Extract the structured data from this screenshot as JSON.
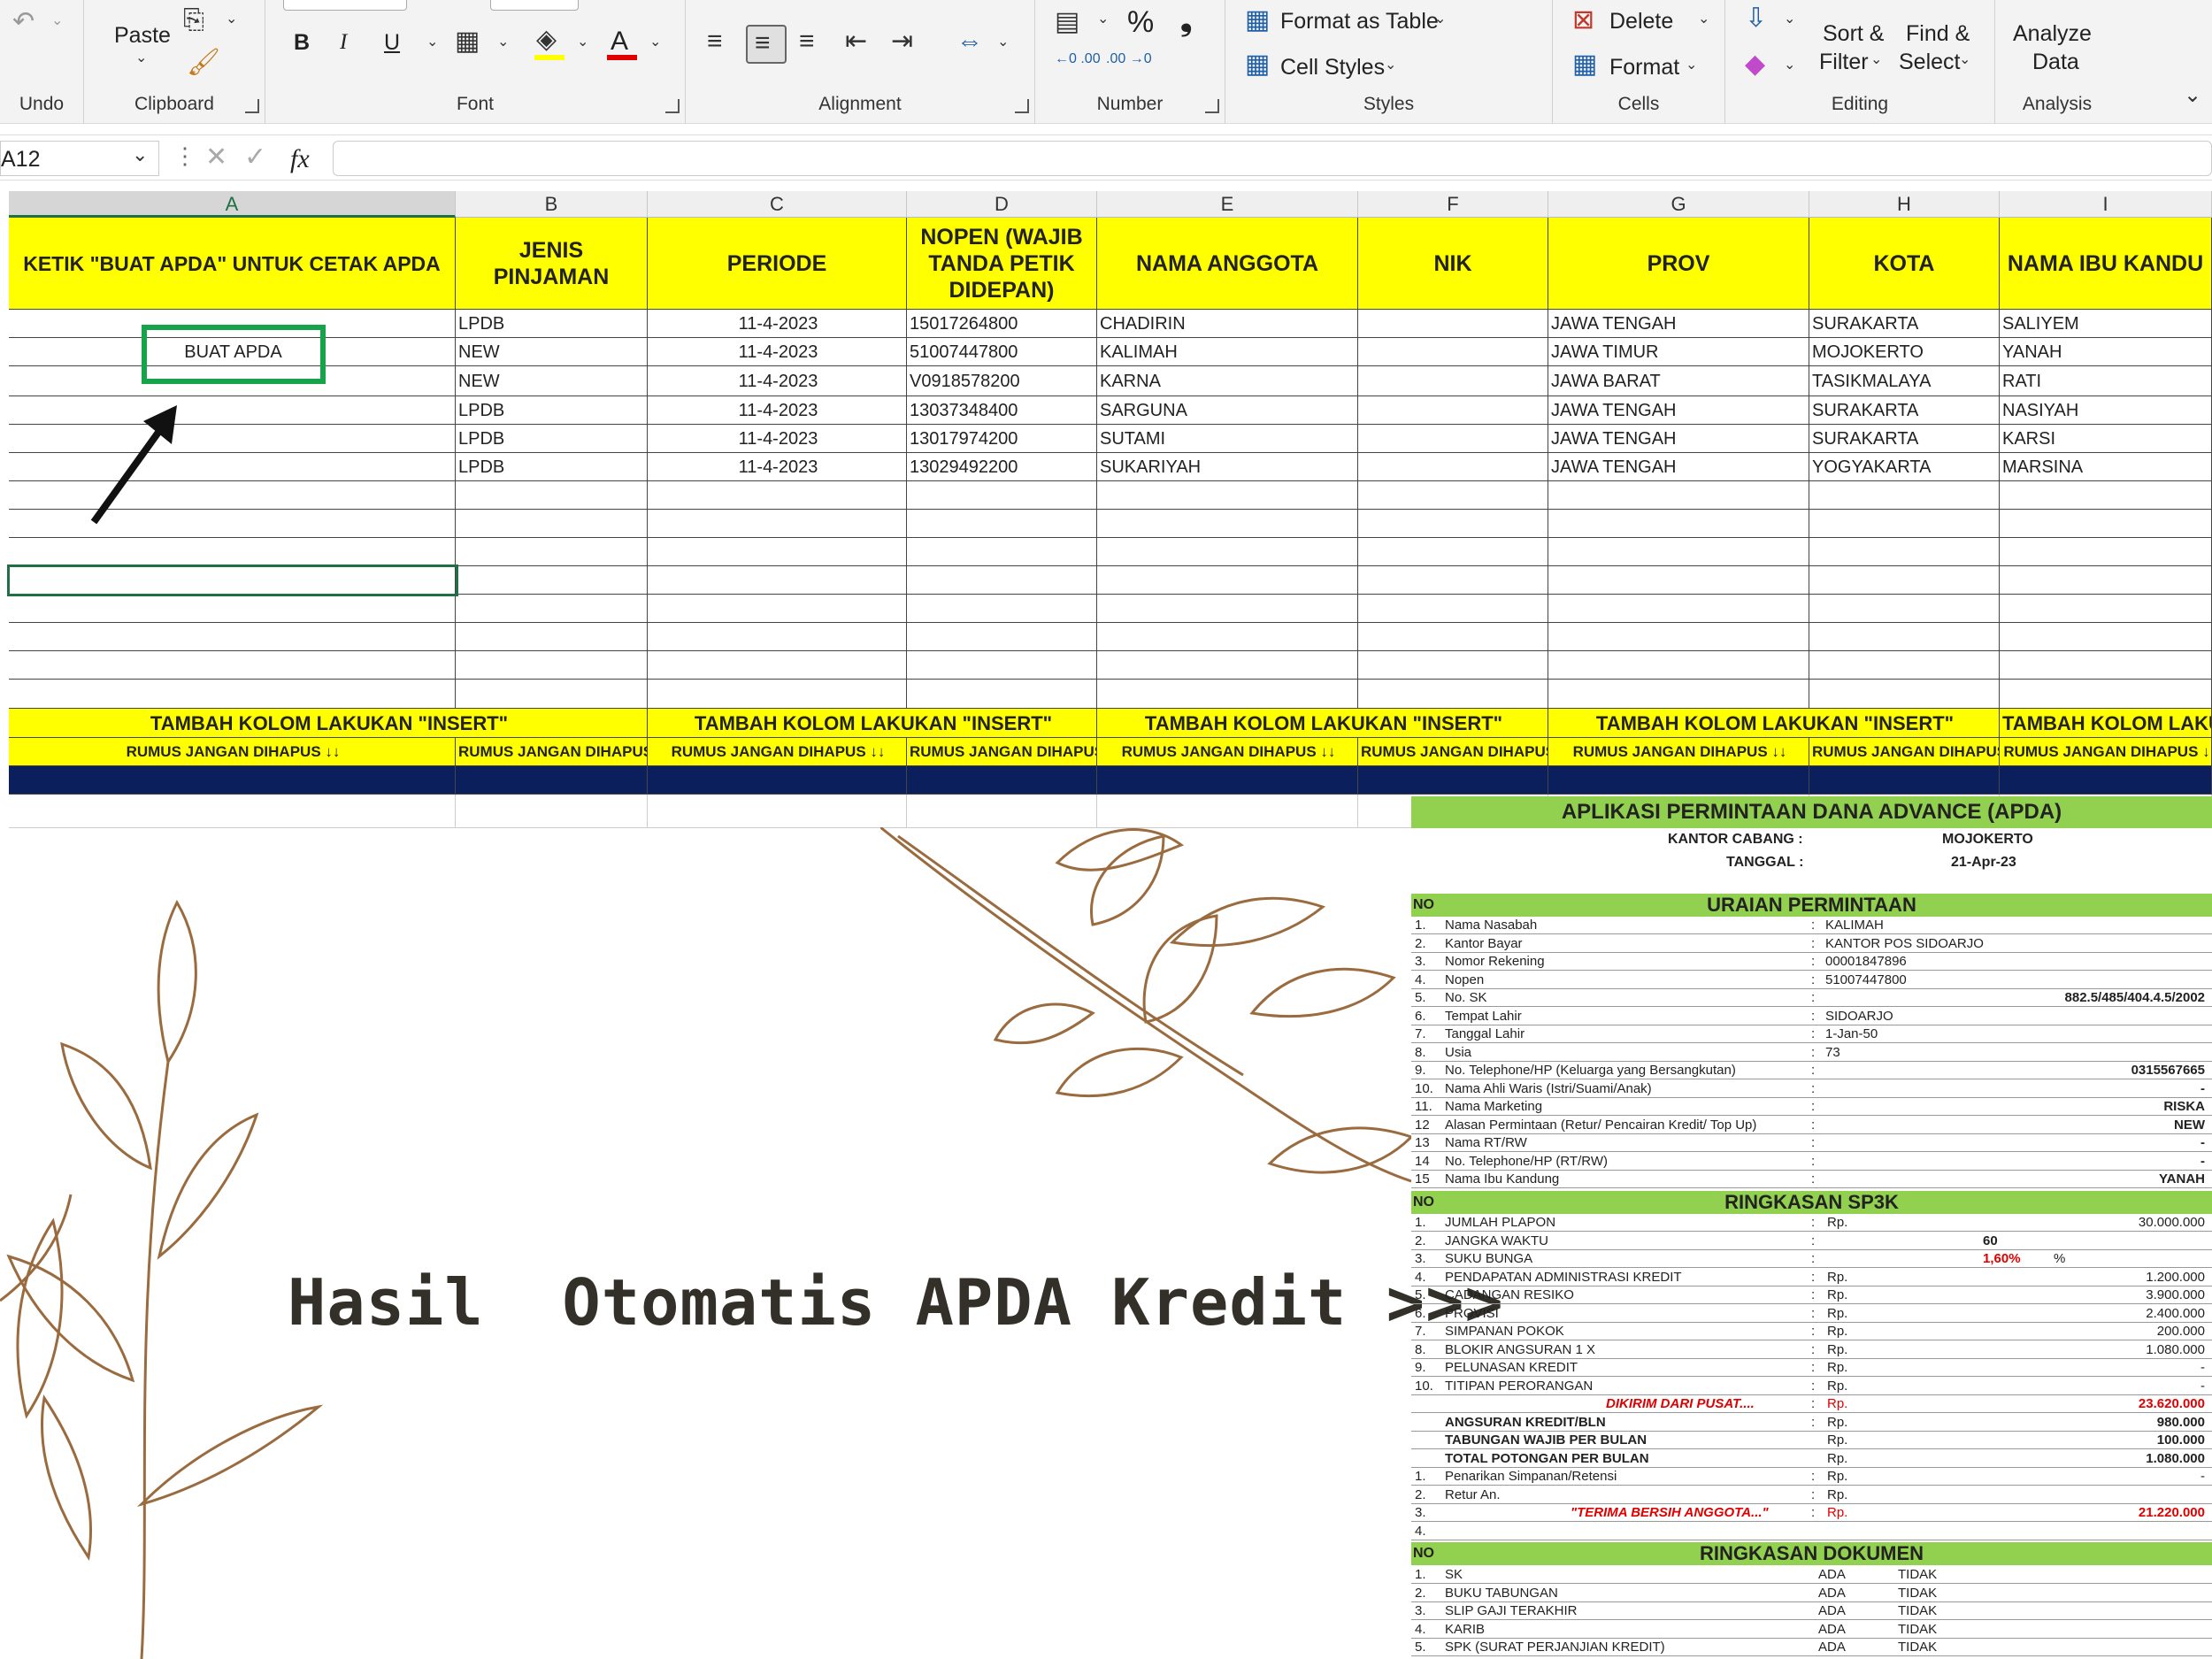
{
  "ribbon": {
    "undo_label": "Undo",
    "clipboard_label": "Clipboard",
    "paste_label": "Paste",
    "font_label": "Font",
    "alignment_label": "Alignment",
    "number_label": "Number",
    "styles_label": "Styles",
    "cells_label": "Cells",
    "editing_label": "Editing",
    "analysis_label": "Analysis",
    "bold": "B",
    "italic": "I",
    "underline": "U",
    "percent": "%",
    "comma": "❟",
    "dec_inc": "←0 .00",
    "dec_dec": ".00 →0",
    "format_as_table": "Format as Table",
    "cell_styles": "Cell Styles",
    "delete": "Delete",
    "format": "Format",
    "sort_filter_1": "Sort &",
    "sort_filter_2": "Filter",
    "find_select_1": "Find &",
    "find_select_2": "Select",
    "analyze_1": "Analyze",
    "analyze_2": "Data"
  },
  "formula_bar": {
    "name_box": "A12",
    "fx": "fx",
    "value": ""
  },
  "columns": [
    "A",
    "B",
    "C",
    "D",
    "E",
    "F",
    "G",
    "H",
    "I"
  ],
  "headers": [
    "KETIK \"BUAT APDA\" UNTUK CETAK APDA",
    "JENIS PINJAMAN",
    "PERIODE",
    "NOPEN (WAJIB TANDA PETIK DIDEPAN)",
    "NAMA ANGGOTA",
    "NIK",
    "PROV",
    "KOTA",
    "NAMA IBU KANDU"
  ],
  "rows": [
    [
      "",
      "LPDB",
      "11-4-2023",
      "15017264800",
      "CHADIRIN",
      "",
      "JAWA TENGAH",
      "SURAKARTA",
      "SALIYEM"
    ],
    [
      "BUAT APDA",
      "NEW",
      "11-4-2023",
      "51007447800",
      "KALIMAH",
      "",
      "JAWA TIMUR",
      "MOJOKERTO",
      "YANAH"
    ],
    [
      "",
      "NEW",
      "11-4-2023",
      "V0918578200",
      "KARNA",
      "",
      "JAWA BARAT",
      "TASIKMALAYA",
      "RATI"
    ],
    [
      "",
      "LPDB",
      "11-4-2023",
      "13037348400",
      "SARGUNA",
      "",
      "JAWA TENGAH",
      "SURAKARTA",
      "NASIYAH"
    ],
    [
      "",
      "LPDB",
      "11-4-2023",
      "13017974200",
      "SUTAMI",
      "",
      "JAWA TENGAH",
      "SURAKARTA",
      "KARSI"
    ],
    [
      "",
      "LPDB",
      "11-4-2023",
      "13029492200",
      "SUKARIYAH",
      "",
      "JAWA TENGAH",
      "YOGYAKARTA",
      "MARSINA"
    ]
  ],
  "insert_notes": [
    "TAMBAH KOLOM LAKUKAN \"INSERT\"",
    "TAMBAH KOLOM LAKUKAN \"INSERT\"",
    "TAMBAH KOLOM LAKUKAN \"INSERT\"",
    "TAMBAH KOLOM LAKUKAN \"INSERT\"",
    "TAMBAH KOLOM LAKUKAN \"I"
  ],
  "formula_notes": [
    "RUMUS JANGAN DIHAPUS ↓↓",
    "RUMUS JANGAN DIHAPUS ↓↓",
    "RUMUS JANGAN DIHAPUS ↓↓",
    "RUMUS JANGAN DIHAPUS ↓↓",
    "RUMUS JANGAN DIHAPUS ↓↓",
    "RUMUS JANGAN DIHAPUS ↓↓",
    "RUMUS JANGAN DIHAPUS ↓↓",
    "RUMUS JANGAN DIHAPUS ↓↓",
    "RUMUS JANGAN DIHAPUS ↓"
  ],
  "banner": "Hasil  Otomatis APDA Kredit >>>",
  "form": {
    "title": "APLIKASI PERMINTAAN DANA ADVANCE (APDA)",
    "branch_label": "KANTOR CABANG :",
    "branch": "MOJOKERTO",
    "date_label": "TANGGAL :",
    "date": "21-Apr-23",
    "no": "NO",
    "sec1": "URAIAN PERMINTAAN",
    "sec1_rows": [
      [
        "1.",
        "Nama Nasabah",
        ":",
        "KALIMAH",
        ""
      ],
      [
        "2.",
        "Kantor Bayar",
        ":",
        "KANTOR POS SIDOARJO",
        ""
      ],
      [
        "3.",
        "Nomor Rekening",
        ":",
        "00001847896",
        ""
      ],
      [
        "4.",
        "Nopen",
        ":",
        "51007447800",
        ""
      ],
      [
        "5.",
        "No. SK",
        ":",
        "",
        "882.5/485/404.4.5/2002"
      ],
      [
        "6.",
        "Tempat Lahir",
        ":",
        "SIDOARJO",
        ""
      ],
      [
        "7.",
        "Tanggal Lahir",
        ":",
        "1-Jan-50",
        ""
      ],
      [
        "8.",
        "Usia",
        ":",
        "73",
        ""
      ],
      [
        "9.",
        "No. Telephone/HP (Keluarga yang Bersangkutan)",
        ":",
        "",
        "0315567665"
      ],
      [
        "10.",
        "Nama Ahli Waris (Istri/Suami/Anak)",
        ":",
        "",
        "-"
      ],
      [
        "11.",
        "Nama Marketing",
        ":",
        "",
        "RISKA"
      ],
      [
        "12",
        "Alasan Permintaan (Retur/ Pencairan Kredit/ Top Up)",
        ":",
        "",
        "NEW"
      ],
      [
        "13",
        "Nama RT/RW",
        ":",
        "",
        "-"
      ],
      [
        "14",
        "No. Telephone/HP (RT/RW)",
        ":",
        "",
        "-"
      ],
      [
        "15",
        "Nama Ibu Kandung",
        ":",
        "",
        "YANAH"
      ]
    ],
    "sec2": "RINGKASAN SP3K",
    "sec2_rows": [
      [
        "1.",
        "JUMLAH PLAPON",
        ":",
        "Rp.",
        "30.000.000"
      ],
      [
        "2.",
        "JANGKA WAKTU",
        ":",
        "",
        "60"
      ],
      [
        "3.",
        "SUKU BUNGA",
        ":",
        "",
        "1,60%"
      ],
      [
        "4.",
        "PENDAPATAN ADMINISTRASI KREDIT",
        ":",
        "Rp.",
        "1.200.000"
      ],
      [
        "5.",
        "CADANGAN RESIKO",
        ":",
        "Rp.",
        "3.900.000"
      ],
      [
        "6.",
        "PROVISI",
        ":",
        "Rp.",
        "2.400.000"
      ],
      [
        "7.",
        "SIMPANAN POKOK",
        ":",
        "Rp.",
        "200.000"
      ],
      [
        "8.",
        "BLOKIR ANGSURAN 1 X",
        ":",
        "Rp.",
        "1.080.000"
      ],
      [
        "9.",
        "PELUNASAN KREDIT",
        ":",
        "Rp.",
        "-"
      ],
      [
        "10.",
        "TITIPAN PERORANGAN",
        ":",
        "Rp.",
        "-"
      ],
      [
        "",
        "DIKIRIM DARI PUSAT....",
        ":",
        "Rp.",
        "23.620.000"
      ],
      [
        "",
        "ANGSURAN KREDIT/BLN",
        ":",
        "Rp.",
        "980.000"
      ],
      [
        "",
        "TABUNGAN WAJIB PER BULAN",
        "",
        "Rp.",
        "100.000"
      ],
      [
        "",
        "TOTAL POTONGAN PER BULAN",
        "",
        "Rp.",
        "1.080.000"
      ],
      [
        "1.",
        "Penarikan Simpanan/Retensi",
        ":",
        "Rp.",
        "-"
      ],
      [
        "2.",
        "Retur An.",
        ":",
        "Rp.",
        ""
      ],
      [
        "3.",
        "\"TERIMA BERSIH ANGGOTA...\"",
        ":",
        "Rp.",
        "21.220.000"
      ],
      [
        "4.",
        "",
        "",
        "",
        ""
      ]
    ],
    "percent_sign": "%",
    "sec3": "RINGKASAN DOKUMEN",
    "sec3_rows": [
      [
        "1.",
        "SK",
        "ADA",
        "TIDAK"
      ],
      [
        "2.",
        "BUKU TABUNGAN",
        "ADA",
        "TIDAK"
      ],
      [
        "3.",
        "SLIP GAJI TERAKHIR",
        "ADA",
        "TIDAK"
      ],
      [
        "4.",
        "KARIB",
        "ADA",
        "TIDAK"
      ],
      [
        "5.",
        "SPK (SURAT PERJANJIAN KREDIT)",
        "ADA",
        "TIDAK"
      ]
    ]
  },
  "colors": {
    "header_yellow": "#ffff00",
    "navy": "#0a1f5c",
    "form_green": "#92d050",
    "brown": "#9a6b3f",
    "select_green": "#1e7145",
    "callout_green": "#16a34a"
  }
}
